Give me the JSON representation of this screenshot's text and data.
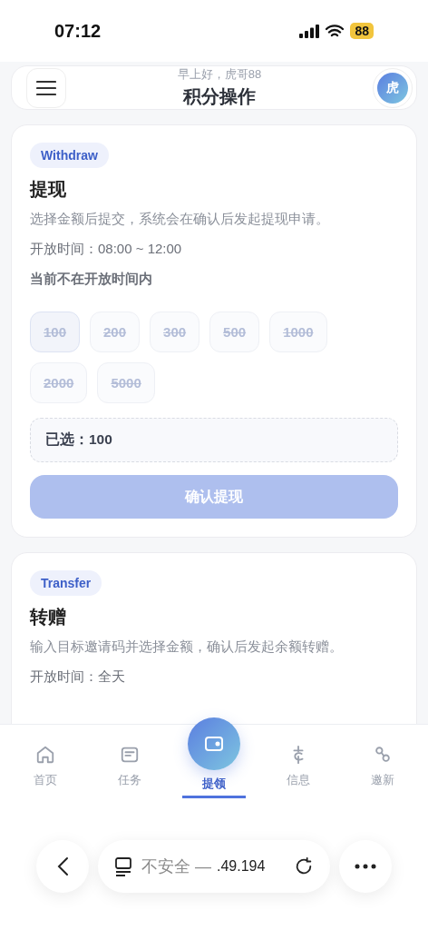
{
  "status_bar": {
    "time": "07:12",
    "battery": "88"
  },
  "header": {
    "greeting": "早上好，虎哥88",
    "title": "积分操作",
    "avatar": "虎"
  },
  "withdraw": {
    "tag": "Withdraw",
    "title": "提现",
    "description": "选择金额后提交，系统会在确认后发起提现申请。",
    "hours": "开放时间：08:00 ~ 12:00",
    "notice": "当前不在开放时间内",
    "amounts": [
      {
        "label": "100",
        "selected": true,
        "disabled": true
      },
      {
        "label": "200",
        "selected": false,
        "disabled": true
      },
      {
        "label": "300",
        "selected": false,
        "disabled": true
      },
      {
        "label": "500",
        "selected": false,
        "disabled": true
      },
      {
        "label": "1000",
        "selected": false,
        "disabled": true
      },
      {
        "label": "2000",
        "selected": false,
        "disabled": true
      },
      {
        "label": "5000",
        "selected": false,
        "disabled": true
      }
    ],
    "selected_label": "已选：100",
    "submit": {
      "label": "确认提现",
      "disabled": true
    }
  },
  "transfer": {
    "tag": "Transfer",
    "title": "转赠",
    "description": "输入目标邀请码并选择金额，确认后发起余额转赠。",
    "hours": "开放时间：全天"
  },
  "tab_bar": [
    {
      "kind": "home",
      "label": "首页",
      "selected": false
    },
    {
      "kind": "tasks",
      "label": "任务",
      "selected": false
    },
    {
      "kind": "wallet",
      "label": "提领",
      "selected": true
    },
    {
      "kind": "info",
      "label": "信息",
      "selected": false
    },
    {
      "kind": "invite",
      "label": "邀新",
      "selected": false
    }
  ],
  "browser_bar": {
    "url_prefix": "不安全 —",
    "url": ".49.194"
  }
}
